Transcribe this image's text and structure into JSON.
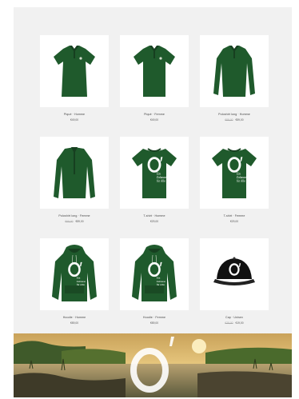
{
  "products": [
    {
      "name": "Piqué · Homme",
      "price": "€49,00",
      "old_price": "",
      "kind": "polo-men"
    },
    {
      "name": "Piqué · Femme",
      "price": "€49,00",
      "old_price": "",
      "kind": "polo-women"
    },
    {
      "name": "Poloshirt long · Homme",
      "price": "€59,00",
      "old_price": "€69,00",
      "kind": "polo-long"
    },
    {
      "name": "Poloshirt long · Femme",
      "price": "€59,00",
      "old_price": "€69,00",
      "kind": "longsleeve-women"
    },
    {
      "name": "T-shirt · Homme",
      "price": "€29,00",
      "old_price": "",
      "kind": "tshirt-men"
    },
    {
      "name": "T-shirt · Femme",
      "price": "€29,00",
      "old_price": "",
      "kind": "tshirt-women"
    },
    {
      "name": "Hoodie · Homme",
      "price": "€89,00",
      "old_price": "",
      "kind": "hoodie-men"
    },
    {
      "name": "Hoodie · Femme",
      "price": "€89,00",
      "old_price": "",
      "kind": "hoodie-women"
    },
    {
      "name": "Cap · Unisex",
      "price": "€19,00",
      "old_price": "€25,00",
      "kind": "cap"
    }
  ],
  "logo": {
    "mark": "O'",
    "tagline_lines": [
      "Ein",
      "Zuhause",
      "für Alle"
    ]
  },
  "colors": {
    "garment": "#1f5a2c",
    "garment_dark": "#173f20",
    "cap": "#111111",
    "print": "#ffffff"
  }
}
